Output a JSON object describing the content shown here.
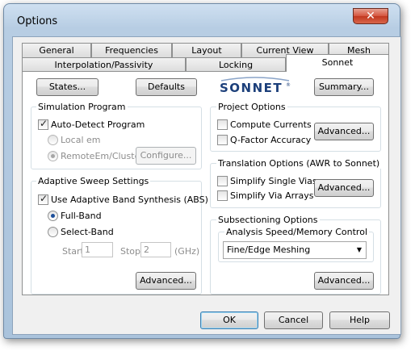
{
  "window": {
    "title": "Options",
    "close_label": "✕"
  },
  "tabs_row1": [
    {
      "label": "General"
    },
    {
      "label": "Frequencies"
    },
    {
      "label": "Layout"
    },
    {
      "label": "Current View"
    },
    {
      "label": "Mesh"
    }
  ],
  "tabs_row2": [
    {
      "label": "Interpolation/Passivity"
    },
    {
      "label": "Locking"
    },
    {
      "label": "Sonnet",
      "active": true
    }
  ],
  "top_buttons": {
    "states": "States...",
    "defaults": "Defaults",
    "summary": "Summary..."
  },
  "logo": {
    "text": "SONNET",
    "mark": "®",
    "color": "#1c3f7a"
  },
  "simulation_program": {
    "title": "Simulation Program",
    "auto_detect": {
      "label": "Auto-Detect Program",
      "checked": true
    },
    "local_em": {
      "label": "Local em",
      "selected": false,
      "enabled": false
    },
    "remote_em": {
      "label": "RemoteEm/Cluster",
      "selected": true,
      "enabled": false
    },
    "configure": "Configure..."
  },
  "adaptive_sweep": {
    "title": "Adaptive Sweep Settings",
    "use_abs": {
      "label": "Use Adaptive Band Synthesis (ABS)",
      "checked": true
    },
    "full_band": {
      "label": "Full-Band",
      "selected": true
    },
    "select_band": {
      "label": "Select-Band",
      "selected": false
    },
    "start_label": "Start",
    "start_value": "1",
    "stop_label": "Stop",
    "stop_value": "2",
    "unit": "(GHz)",
    "advanced": "Advanced..."
  },
  "project_options": {
    "title": "Project Options",
    "compute_currents": {
      "label": "Compute Currents",
      "checked": false
    },
    "q_factor": {
      "label": "Q-Factor Accuracy",
      "checked": false
    },
    "advanced": "Advanced..."
  },
  "translation_options": {
    "title": "Translation Options (AWR to Sonnet)",
    "simplify_single_vias": {
      "label": "Simplify Single Vias",
      "checked": false
    },
    "simplify_via_arrays": {
      "label": "Simplify Via Arrays",
      "checked": false
    },
    "advanced": "Advanced..."
  },
  "subsectioning": {
    "title": "Subsectioning Options",
    "analysis_title": "Analysis Speed/Memory Control",
    "selected": "Fine/Edge Meshing",
    "advanced": "Advanced..."
  },
  "footer": {
    "ok": "OK",
    "cancel": "Cancel",
    "help": "Help"
  }
}
